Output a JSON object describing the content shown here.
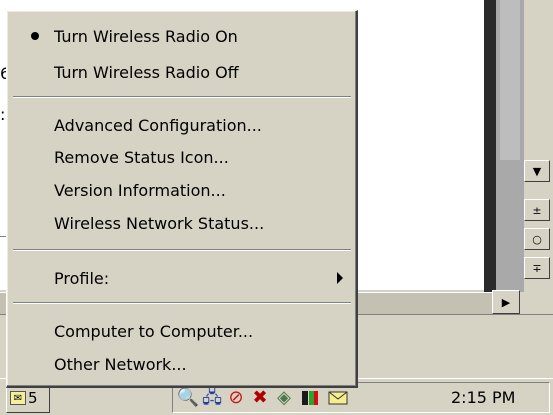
{
  "menu": {
    "items": [
      {
        "label": "Turn Wireless Radio On",
        "checked": true
      },
      {
        "label": "Turn Wireless Radio Off",
        "checked": false
      },
      {
        "label": "Advanced Configuration..."
      },
      {
        "label": "Remove Status Icon..."
      },
      {
        "label": "Version Information..."
      },
      {
        "label": "Wireless Network Status..."
      },
      {
        "label": "Profile:",
        "submenu": true
      },
      {
        "label": "Computer to Computer..."
      },
      {
        "label": "Other Network..."
      }
    ]
  },
  "background_doc": {
    "fragments": [
      "6",
      ":"
    ]
  },
  "scrollbar": {
    "down_arrow": "▼",
    "prev_page": "±",
    "select_browse": "○",
    "next_page": "∓",
    "right_arrow": "▶"
  },
  "taskbar": {
    "task_button_label": "5",
    "clock": "2:15 PM",
    "tray_icons": [
      "search-icon",
      "network-icon",
      "no-entry-icon",
      "disconnected-network-icon",
      "drive-icon",
      "wireless-status-icon",
      "mail-icon"
    ]
  },
  "colors": {
    "face": "#d6d2c4",
    "highlight": "#ffffff",
    "shadow": "#404040"
  }
}
